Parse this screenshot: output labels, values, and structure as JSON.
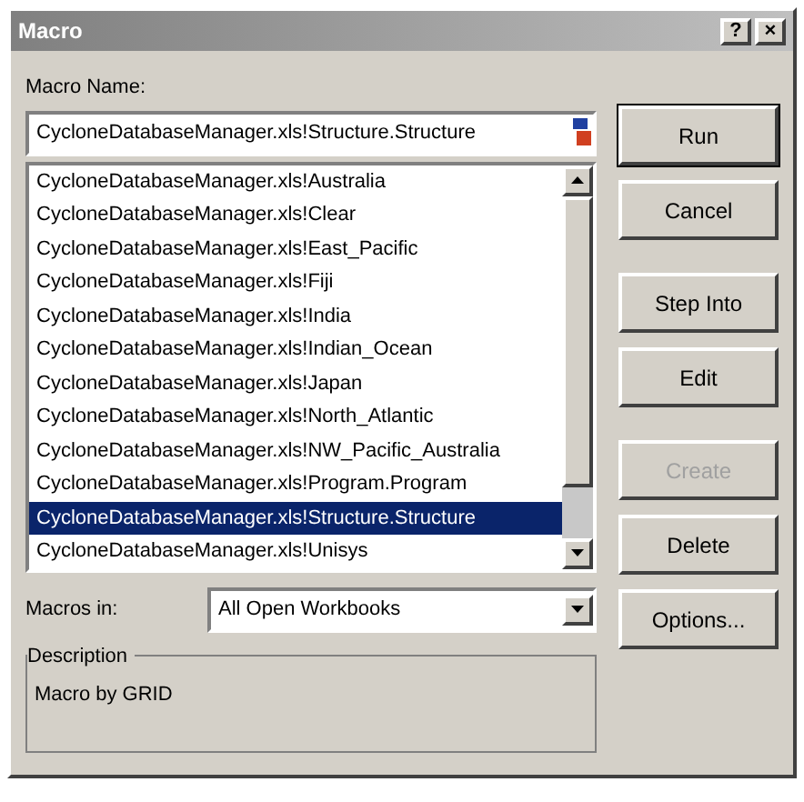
{
  "window": {
    "title": "Macro",
    "title_buttons": [
      "?",
      "×"
    ]
  },
  "macro_name": {
    "label": "Macro Name:",
    "value": "CycloneDatabaseManager.xls!Structure.Structure"
  },
  "macros": [
    {
      "name": "CycloneDatabaseManager.xls!Australia",
      "selected": false
    },
    {
      "name": "CycloneDatabaseManager.xls!Clear",
      "selected": false
    },
    {
      "name": "CycloneDatabaseManager.xls!East_Pacific",
      "selected": false
    },
    {
      "name": "CycloneDatabaseManager.xls!Fiji",
      "selected": false
    },
    {
      "name": "CycloneDatabaseManager.xls!India",
      "selected": false
    },
    {
      "name": "CycloneDatabaseManager.xls!Indian_Ocean",
      "selected": false
    },
    {
      "name": "CycloneDatabaseManager.xls!Japan",
      "selected": false
    },
    {
      "name": "CycloneDatabaseManager.xls!North_Atlantic",
      "selected": false
    },
    {
      "name": "CycloneDatabaseManager.xls!NW_Pacific_Australia",
      "selected": false
    },
    {
      "name": "CycloneDatabaseManager.xls!Program.Program",
      "selected": false
    },
    {
      "name": "CycloneDatabaseManager.xls!Structure.Structure",
      "selected": true
    },
    {
      "name": "CycloneDatabaseManager.xls!Unisys",
      "selected": false
    }
  ],
  "macros_in": {
    "label": "Macros in:",
    "value": "All Open Workbooks"
  },
  "description": {
    "label": "Description",
    "text": "Macro by GRID"
  },
  "buttons": [
    {
      "label": "Run",
      "disabled": false
    },
    {
      "label": "Cancel",
      "disabled": false
    },
    {
      "label": "Step Into",
      "disabled": false
    },
    {
      "label": "Edit",
      "disabled": false
    },
    {
      "label": "Create",
      "disabled": true
    },
    {
      "label": "Delete",
      "disabled": false
    },
    {
      "label": "Options...",
      "disabled": false
    }
  ]
}
